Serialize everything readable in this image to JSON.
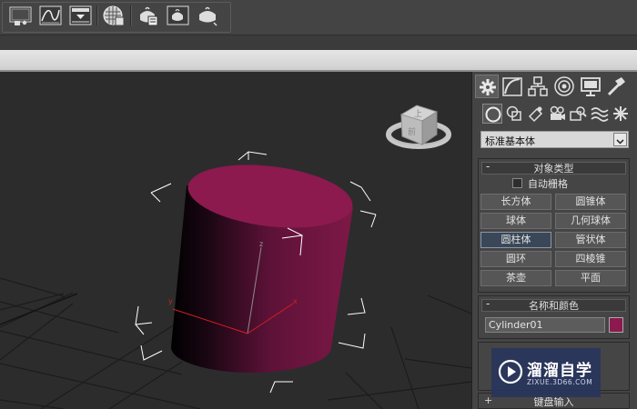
{
  "toolbar": {
    "buttons": [
      {
        "icon": "viewport-layout-icon"
      },
      {
        "icon": "curve-editor-icon"
      },
      {
        "icon": "render-frame-icon"
      },
      {
        "icon": "material-editor-icon"
      },
      {
        "icon": "render-setup-icon"
      },
      {
        "icon": "rendered-frame-window-icon"
      },
      {
        "icon": "render-production-icon"
      }
    ]
  },
  "command_panel": {
    "tabs": [
      {
        "icon": "create-tab-icon",
        "active": true
      },
      {
        "icon": "modify-tab-icon"
      },
      {
        "icon": "hierarchy-tab-icon"
      },
      {
        "icon": "motion-tab-icon"
      },
      {
        "icon": "display-tab-icon"
      },
      {
        "icon": "utilities-tab-icon"
      }
    ],
    "sub_categories": [
      {
        "icon": "geometry-icon",
        "active": true
      },
      {
        "icon": "shapes-icon"
      },
      {
        "icon": "lights-icon"
      },
      {
        "icon": "cameras-icon"
      },
      {
        "icon": "helpers-icon"
      },
      {
        "icon": "space-warps-icon"
      },
      {
        "icon": "systems-icon"
      }
    ],
    "category_dropdown": {
      "value": "标准基本体"
    },
    "object_type": {
      "sign": "-",
      "title": "对象类型",
      "autogrid_label": "自动栅格",
      "buttons": [
        {
          "label": "长方体"
        },
        {
          "label": "圆锥体"
        },
        {
          "label": "球体"
        },
        {
          "label": "几何球体"
        },
        {
          "label": "圆柱体",
          "active": true
        },
        {
          "label": "管状体"
        },
        {
          "label": "圆环"
        },
        {
          "label": "四棱锥"
        },
        {
          "label": "茶壶"
        },
        {
          "label": "平面"
        }
      ]
    },
    "name_and_color": {
      "sign": "-",
      "title": "名称和颜色",
      "name_value": "Cylinder01",
      "color": "#8c1a4e"
    },
    "keyboard_entry": {
      "sign": "+",
      "title": "键盘输入"
    }
  },
  "viewport": {
    "object": "cylinder",
    "object_color": "#8c1a4e",
    "axis_labels": {
      "z": "z",
      "x": "x",
      "y": "y"
    },
    "viewcube_faces": {
      "top": "上",
      "front": "前"
    }
  },
  "watermark": {
    "title": "溜溜自学",
    "url": "ZIXUE.3D66.COM"
  },
  "colors": {
    "panel_bg": "#444444",
    "viewport_bg": "#2c2c2c",
    "active_button": "#3a4758",
    "watermark_bg": "#28345f"
  }
}
